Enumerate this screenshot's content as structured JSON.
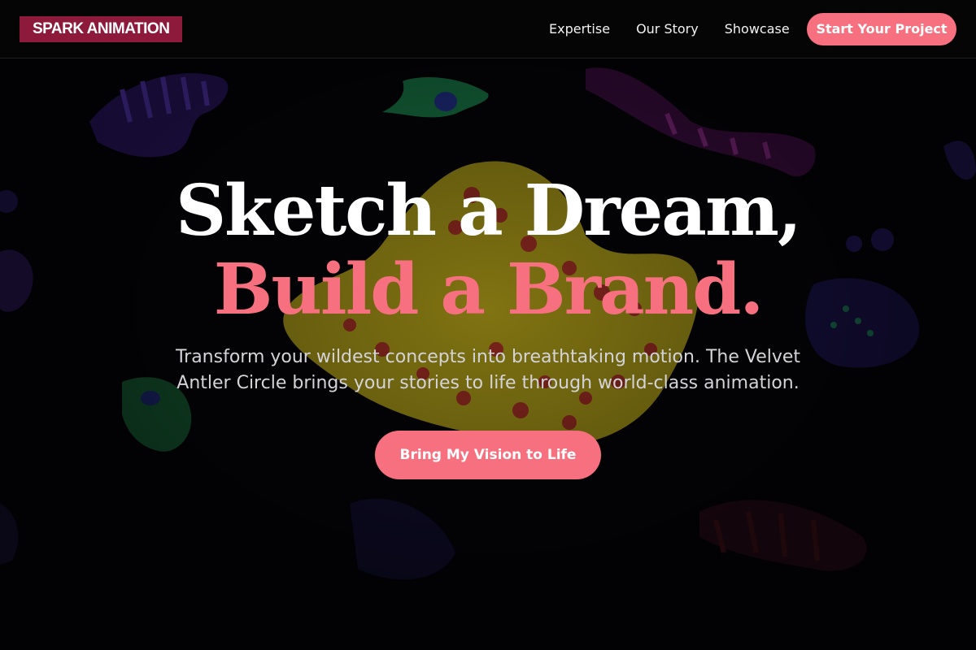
{
  "brand": {
    "logo_text": "SPARK ANIMATION",
    "logo_bg": "#8e1a3b",
    "accent": "#f7707f"
  },
  "nav": {
    "links": [
      "Expertise",
      "Our Story",
      "Showcase"
    ],
    "cta_label": "Start Your Project"
  },
  "hero": {
    "title_line1": "Sketch a Dream,",
    "title_line2": "Build a Brand.",
    "subtitle": "Transform your wildest concepts into breathtaking motion. The Velvet Antler Circle brings your stories to life through world-class animation.",
    "cta_label": "Bring My Vision to Life",
    "background_image": "dark psychedelic creatures artwork"
  }
}
